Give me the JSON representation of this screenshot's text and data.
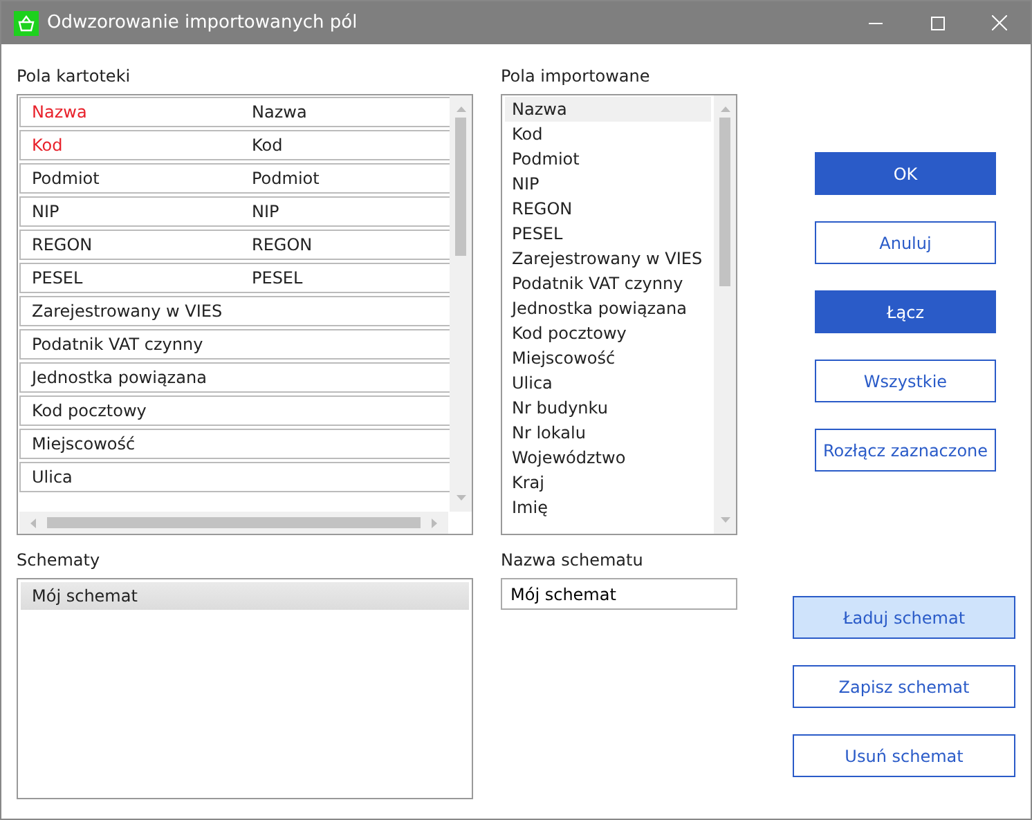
{
  "window": {
    "title": "Odwzorowanie importowanych pól"
  },
  "card_fields": {
    "label": "Pola kartoteki",
    "rows": [
      {
        "field": "Nazwa",
        "mapped": "Nazwa",
        "required": true
      },
      {
        "field": "Kod",
        "mapped": "Kod",
        "required": true
      },
      {
        "field": "Podmiot",
        "mapped": "Podmiot",
        "required": false
      },
      {
        "field": "NIP",
        "mapped": "NIP",
        "required": false
      },
      {
        "field": "REGON",
        "mapped": "REGON",
        "required": false
      },
      {
        "field": "PESEL",
        "mapped": "PESEL",
        "required": false
      },
      {
        "field": "Zarejestrowany w VIES",
        "required": false
      },
      {
        "field": "Podatnik VAT czynny",
        "required": false
      },
      {
        "field": "Jednostka powiązana",
        "required": false
      },
      {
        "field": "Kod pocztowy",
        "required": false
      },
      {
        "field": "Miejscowość",
        "required": false
      },
      {
        "field": "Ulica",
        "required": false
      }
    ]
  },
  "imported_fields": {
    "label": "Pola importowane",
    "items": [
      {
        "text": "Nazwa",
        "selected": true
      },
      {
        "text": "Kod",
        "selected": false
      },
      {
        "text": "Podmiot",
        "selected": false
      },
      {
        "text": "NIP",
        "selected": false
      },
      {
        "text": "REGON",
        "selected": false
      },
      {
        "text": "PESEL",
        "selected": false
      },
      {
        "text": "Zarejestrowany w VIES",
        "selected": false
      },
      {
        "text": "Podatnik VAT czynny",
        "selected": false
      },
      {
        "text": "Jednostka powiązana",
        "selected": false
      },
      {
        "text": "Kod pocztowy",
        "selected": false
      },
      {
        "text": "Miejscowość",
        "selected": false
      },
      {
        "text": "Ulica",
        "selected": false
      },
      {
        "text": "Nr budynku",
        "selected": false
      },
      {
        "text": "Nr lokalu",
        "selected": false
      },
      {
        "text": "Województwo",
        "selected": false
      },
      {
        "text": "Kraj",
        "selected": false
      },
      {
        "text": "Imię",
        "selected": false
      }
    ]
  },
  "action_buttons": [
    {
      "label": "OK",
      "kind": "primary"
    },
    {
      "label": "Anuluj",
      "kind": "outline"
    },
    {
      "label": "Łącz",
      "kind": "primary"
    },
    {
      "label": "Wszystkie",
      "kind": "outline"
    },
    {
      "label": "Rozłącz zaznaczone",
      "kind": "outline"
    }
  ],
  "schemes": {
    "label": "Schematy",
    "items": [
      {
        "text": "Mój schemat",
        "selected": true
      }
    ]
  },
  "scheme_name": {
    "label": "Nazwa schematu",
    "value": "Mój schemat"
  },
  "scheme_buttons": [
    {
      "label": "Ładuj schemat",
      "kind": "highlighted"
    },
    {
      "label": "Zapisz schemat",
      "kind": "outline"
    },
    {
      "label": "Usuń schemat",
      "kind": "outline"
    }
  ]
}
